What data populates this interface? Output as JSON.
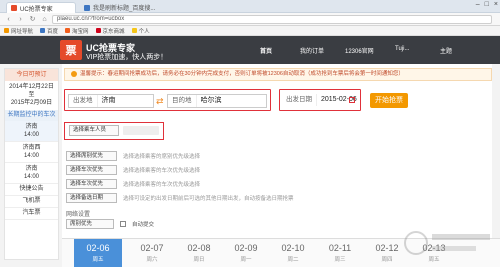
{
  "browser": {
    "tabs": [
      {
        "label": "UC抢票专家",
        "active": true
      },
      {
        "label": "我是刷新标题_百度搜...",
        "active": false
      }
    ],
    "window_controls": [
      "–",
      "□",
      "×"
    ],
    "address": "plaeu.uc.cn/?from=ucbox",
    "bookmarks": [
      "网址导航",
      "百度",
      "淘宝网",
      "京东商城",
      "个人"
    ]
  },
  "header": {
    "logo": "票",
    "title": "UC抢票专家",
    "slogan": "VIP抢票加速，快人两步！",
    "nav": [
      "首页",
      "我的订单",
      "12306官网",
      "Tuji..."
    ],
    "nav_right": "主题"
  },
  "left": {
    "head": "今日可预订",
    "date_line1": "2014年12月22日",
    "date_line2": "至",
    "date_line3": "2015年2月09日",
    "sub": "长期监控中的车次",
    "trains": [
      {
        "name": "济南",
        "time": "14:00"
      },
      {
        "name": "济南西",
        "time": "14:00"
      },
      {
        "name": "济南",
        "time": "14:00"
      }
    ],
    "categories": [
      "快捷公告",
      "飞机票",
      "汽车票"
    ]
  },
  "main": {
    "notice": "温馨提示：春运期间抢票成功后，请务必在30分钟内完成支付，否则订单将被12306自动取消（成功抢到车票后将会第一时间通知您）",
    "from_label": "出发地",
    "from_value": "济南",
    "to_label": "目的地",
    "to_value": "哈尔滨",
    "date_label": "出发日期",
    "date_value": "2015-02-06",
    "start_button": "开始抢票",
    "passenger_select": "选择乘车人员",
    "options": [
      {
        "select": "选择席别优先",
        "hint": "选择选择乘客的席别优先级选择"
      },
      {
        "select": "选择车次优先",
        "hint": "选择选择乘客的车次优先级选择"
      },
      {
        "select": "选择车次优先",
        "hint": "选择选择乘客的车次优先级选择"
      },
      {
        "select": "选择备选日期",
        "hint": "选择可设定的出发日期前后可选的其他日期出发，自动按备选日期抢票"
      }
    ],
    "network_label": "网络设置",
    "network_select": "席别优先",
    "auto_submit": "自动提交"
  },
  "date_strip": [
    {
      "d": "02-06",
      "w": "周五",
      "selected": true
    },
    {
      "d": "02-07",
      "w": "周六",
      "selected": false
    },
    {
      "d": "02-08",
      "w": "周日",
      "selected": false
    },
    {
      "d": "02-09",
      "w": "周一",
      "selected": false
    },
    {
      "d": "02-10",
      "w": "周二",
      "selected": false
    },
    {
      "d": "02-11",
      "w": "周三",
      "selected": false
    },
    {
      "d": "02-12",
      "w": "周四",
      "selected": false
    },
    {
      "d": "02-13",
      "w": "周五",
      "selected": false
    }
  ],
  "colors": {
    "accent_red": "#e0313a",
    "start_orange": "#f39800",
    "header_dark": "#3a3d42",
    "date_selected": "#4a90d9"
  }
}
